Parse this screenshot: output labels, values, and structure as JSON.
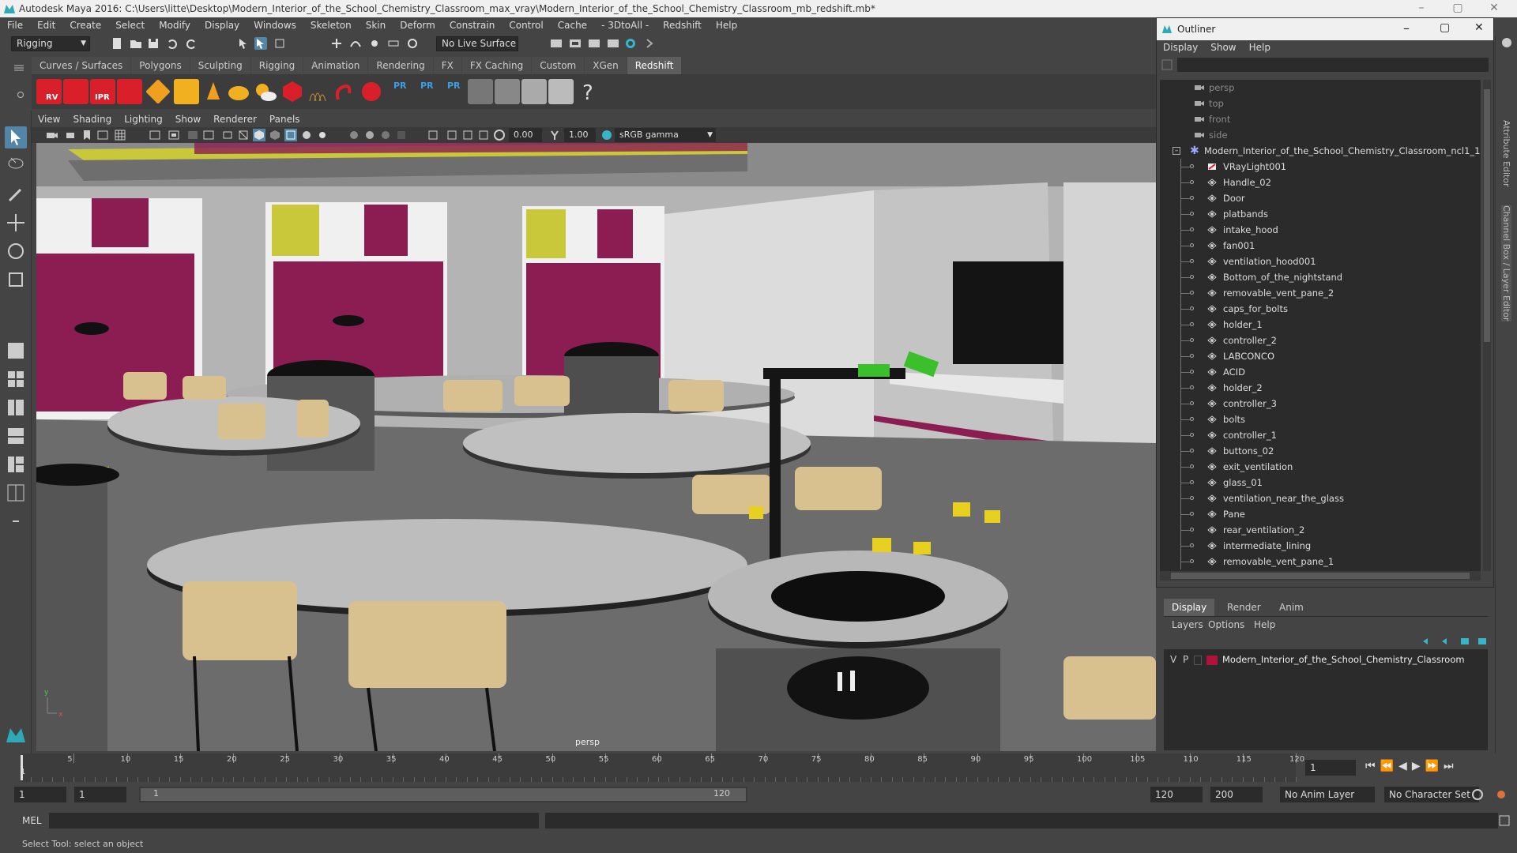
{
  "window": {
    "title": "Autodesk Maya 2016: C:\\Users\\litte\\Desktop\\Modern_Interior_of_the_School_Chemistry_Classroom_max_vray\\Modern_Interior_of_the_School_Chemistry_Classroom_mb_redshift.mb*",
    "controls": [
      "–",
      "▢",
      "✕"
    ]
  },
  "menubar": [
    "File",
    "Edit",
    "Create",
    "Select",
    "Modify",
    "Display",
    "Windows",
    "Skeleton",
    "Skin",
    "Deform",
    "Constrain",
    "Control",
    "Cache",
    "- 3DtoAll -",
    "Redshift",
    "Help"
  ],
  "status_line": {
    "mode": "Rigging",
    "live_surface": "No Live Surface"
  },
  "shelf": {
    "tabs": [
      "Curves / Surfaces",
      "Polygons",
      "Sculpting",
      "Rigging",
      "Animation",
      "Rendering",
      "FX",
      "FX Caching",
      "Custom",
      "XGen",
      "Redshift"
    ],
    "active_tab": "Redshift",
    "icon_labels": [
      "RV",
      "IPR",
      "PR",
      "PR",
      "PR"
    ]
  },
  "viewport": {
    "menu": [
      "View",
      "Shading",
      "Lighting",
      "Show",
      "Renderer",
      "Panels"
    ],
    "exposure": "0.00",
    "gamma": "1.00",
    "color_space": "sRGB gamma",
    "camera_label": "persp",
    "axis_y": "y",
    "axis_x": "x"
  },
  "outliner": {
    "title": "Outliner",
    "menu": [
      "Display",
      "Show",
      "Help"
    ],
    "cameras": [
      "persp",
      "top",
      "front",
      "side"
    ],
    "group": "Modern_Interior_of_the_School_Chemistry_Classroom_ncl1_1",
    "items": [
      "VRayLight001",
      "Handle_02",
      "Door",
      "platbands",
      "intake_hood",
      "fan001",
      "ventilation_hood001",
      "Bottom_of_the_nightstand",
      "removable_vent_pane_2",
      "caps_for_bolts",
      "holder_1",
      "controller_2",
      "LABCONCO",
      "ACID",
      "holder_2",
      "controller_3",
      "bolts",
      "controller_1",
      "buttons_02",
      "exit_ventilation",
      "glass_01",
      "ventilation_near_the_glass",
      "Pane",
      "rear_ventilation_2",
      "intermediate_lining",
      "removable_vent_pane_1"
    ]
  },
  "side_tabs": [
    "Attribute Editor",
    "Channel Box / Layer Editor"
  ],
  "layer_editor": {
    "tabs": [
      "Display",
      "Render",
      "Anim"
    ],
    "active_tab": "Display",
    "menu": [
      "Layers",
      "Options",
      "Help"
    ],
    "layer": {
      "v": "V",
      "p": "P",
      "name": "Modern_Interior_of_the_School_Chemistry_Classroom",
      "color": "#b0123a"
    }
  },
  "timeline": {
    "ticks": [
      "5",
      "10",
      "15",
      "20",
      "25",
      "30",
      "35",
      "40",
      "45",
      "50",
      "55",
      "60",
      "65",
      "70",
      "75",
      "80",
      "85",
      "90",
      "95",
      "100",
      "105",
      "110",
      "115",
      "120"
    ],
    "first_tick": "1",
    "current_frame": "1"
  },
  "range": {
    "start": "1",
    "start_inner": "1",
    "slider_start": "1",
    "slider_end": "120",
    "end_inner": "120",
    "end": "200",
    "anim_layer": "No Anim Layer",
    "character_set": "No Character Set"
  },
  "command_line": {
    "label": "MEL"
  },
  "help_line": "Select Tool: select an object",
  "colors": {
    "ui_bg": "#444444",
    "field_bg": "#2b2b2b",
    "accent_cyan": "#36b4c8",
    "redshift_red": "#d9202a",
    "magenta_panel": "#8c1d52",
    "yellow_panel": "#c8c83a",
    "green_tip": "#3bbf2a"
  }
}
